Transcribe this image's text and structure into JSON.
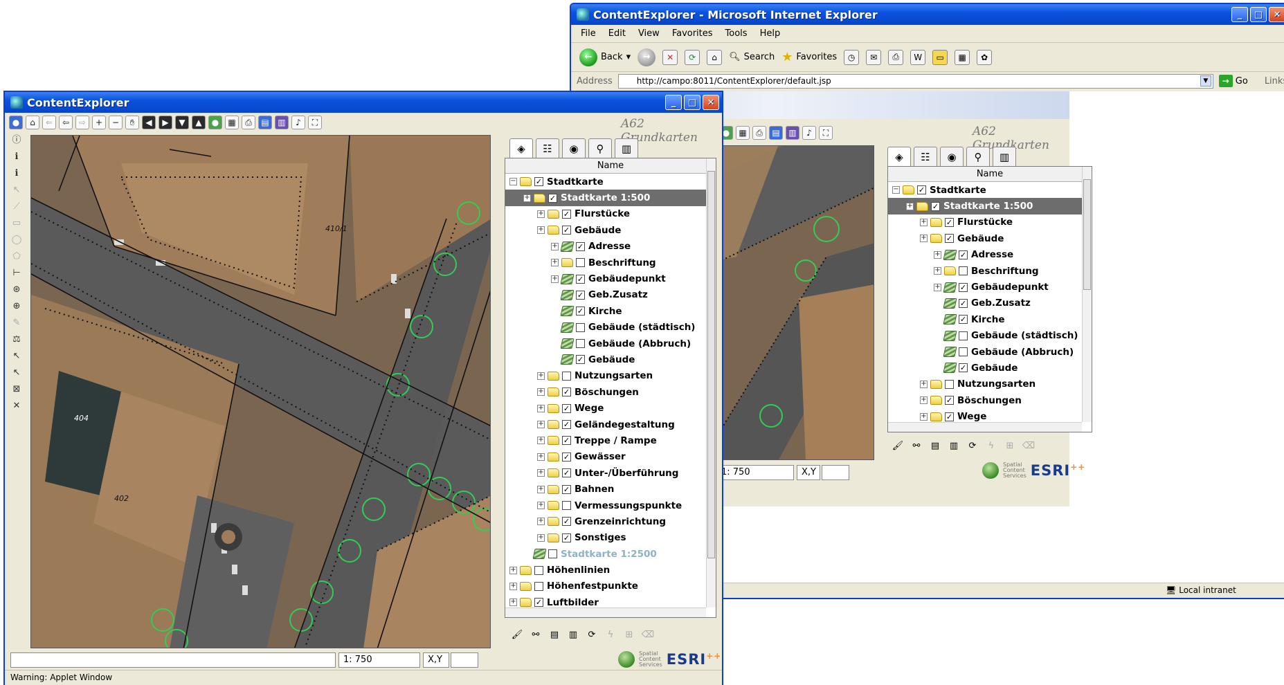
{
  "ie_window": {
    "title": "ContentExplorer - Microsoft Internet Explorer",
    "menu": [
      "File",
      "Edit",
      "View",
      "Favorites",
      "Tools",
      "Help"
    ],
    "toolbar": {
      "back": "Back",
      "search": "Search",
      "favorites": "Favorites"
    },
    "address_label": "Address",
    "address_url": "http://campo:8011/ContentExplorer/default.jsp",
    "go_label": "Go",
    "links_label": "Links",
    "status_zone": "Local intranet"
  },
  "applet": {
    "title": "ContentExplorer",
    "map_title": "A62 Grundkarten",
    "tree_header": "Name",
    "scale_value": "1: 750",
    "xy_label": "X,Y",
    "warning": "Warning: Applet Window",
    "brand": {
      "spatial": "Spatial",
      "content": "Content",
      "services": "Services",
      "esri": "ESRI"
    },
    "map_labels": [
      "410/1",
      "404",
      "402"
    ]
  },
  "tree": [
    {
      "label": "Stadtkarte",
      "level": 0,
      "icon": "folder",
      "checked": true,
      "expander": "-"
    },
    {
      "label": "Stadtkarte 1:500",
      "level": 1,
      "icon": "folder",
      "checked": true,
      "expander": "+",
      "selected": true
    },
    {
      "label": "Flurstücke",
      "level": 2,
      "icon": "folder",
      "checked": true,
      "expander": "+"
    },
    {
      "label": "Gebäude",
      "level": 2,
      "icon": "folder",
      "checked": true,
      "expander": "+"
    },
    {
      "label": "Adresse",
      "level": 3,
      "icon": "layer",
      "checked": true,
      "expander": "+"
    },
    {
      "label": "Beschriftung",
      "level": 3,
      "icon": "folder",
      "checked": false,
      "expander": "+"
    },
    {
      "label": "Gebäudepunkt",
      "level": 3,
      "icon": "layer",
      "checked": true,
      "expander": "+"
    },
    {
      "label": "Geb.Zusatz",
      "level": 3,
      "icon": "layer",
      "checked": true,
      "expander": ""
    },
    {
      "label": "Kirche",
      "level": 3,
      "icon": "layer",
      "checked": true,
      "expander": ""
    },
    {
      "label": "Gebäude (städtisch)",
      "level": 3,
      "icon": "layer",
      "checked": false,
      "expander": ""
    },
    {
      "label": "Gebäude (Abbruch)",
      "level": 3,
      "icon": "layer",
      "checked": false,
      "expander": ""
    },
    {
      "label": "Gebäude",
      "level": 3,
      "icon": "layer",
      "checked": true,
      "expander": ""
    },
    {
      "label": "Nutzungsarten",
      "level": 2,
      "icon": "folder",
      "checked": false,
      "expander": "+"
    },
    {
      "label": "Böschungen",
      "level": 2,
      "icon": "folder",
      "checked": true,
      "expander": "+"
    },
    {
      "label": "Wege",
      "level": 2,
      "icon": "folder",
      "checked": true,
      "expander": "+"
    },
    {
      "label": "Geländegestaltung",
      "level": 2,
      "icon": "folder",
      "checked": true,
      "expander": "+"
    },
    {
      "label": "Treppe / Rampe",
      "level": 2,
      "icon": "folder",
      "checked": true,
      "expander": "+"
    },
    {
      "label": "Gewässer",
      "level": 2,
      "icon": "folder",
      "checked": true,
      "expander": "+"
    },
    {
      "label": "Unter-/Überführung",
      "level": 2,
      "icon": "folder",
      "checked": true,
      "expander": "+"
    },
    {
      "label": "Bahnen",
      "level": 2,
      "icon": "folder",
      "checked": true,
      "expander": "+"
    },
    {
      "label": "Vermessungspunkte",
      "level": 2,
      "icon": "folder",
      "checked": false,
      "expander": "+"
    },
    {
      "label": "Grenzeinrichtung",
      "level": 2,
      "icon": "folder",
      "checked": true,
      "expander": "+"
    },
    {
      "label": "Sonstiges",
      "level": 2,
      "icon": "folder",
      "checked": true,
      "expander": "+"
    },
    {
      "label": "Stadtkarte 1:2500",
      "level": 1,
      "icon": "layer",
      "checked": false,
      "expander": "",
      "dimmed": true
    },
    {
      "label": "Höhenlinien",
      "level": 0,
      "icon": "folder",
      "checked": false,
      "expander": "+"
    },
    {
      "label": "Höhenfestpunkte",
      "level": 0,
      "icon": "folder",
      "checked": false,
      "expander": "+"
    },
    {
      "label": "Luftbilder",
      "level": 0,
      "icon": "folder",
      "checked": true,
      "expander": "+"
    }
  ],
  "back_tree_visible_count": 15,
  "colors": {
    "xp_blue": "#0a3fd4",
    "window_face": "#ece9d8",
    "selected_row": "#6d6d6d",
    "dimmed_text": "#8fb2c4",
    "map_street": "#5a5a5a",
    "map_building": "#a07d5a"
  }
}
